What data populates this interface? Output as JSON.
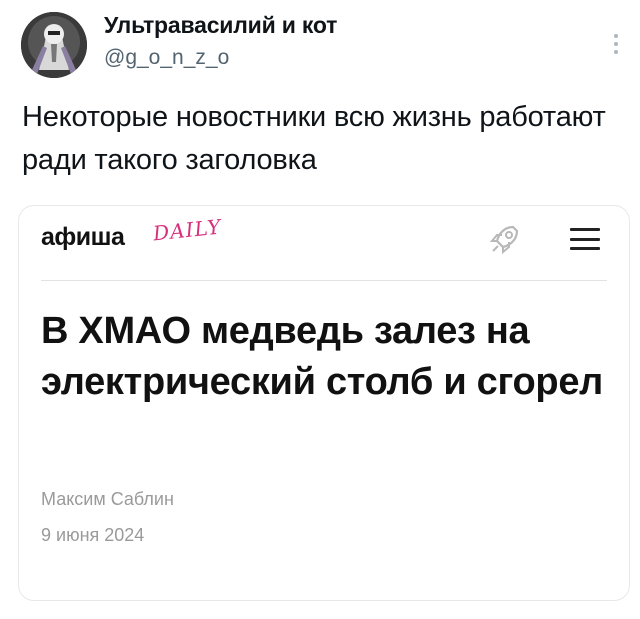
{
  "tweet": {
    "display_name": "Ультравасилий и кот",
    "handle": "@g_o_n_z_o",
    "text": "Некоторые новостники всю жизнь работают ради такого заголовка",
    "avatar_icon": "robot-avatar-icon",
    "more_icon": "more-vertical-icon"
  },
  "card": {
    "brand": "афиша",
    "brand_sub": "DAILY",
    "brand_sub_color": "#d6307c",
    "rocket_icon": "rocket-icon",
    "menu_icon": "hamburger-menu-icon",
    "headline": "В ХМАО медведь залез на электрический столб и сгорел",
    "author": "Максим Саблин",
    "date": "9 июня 2024"
  }
}
